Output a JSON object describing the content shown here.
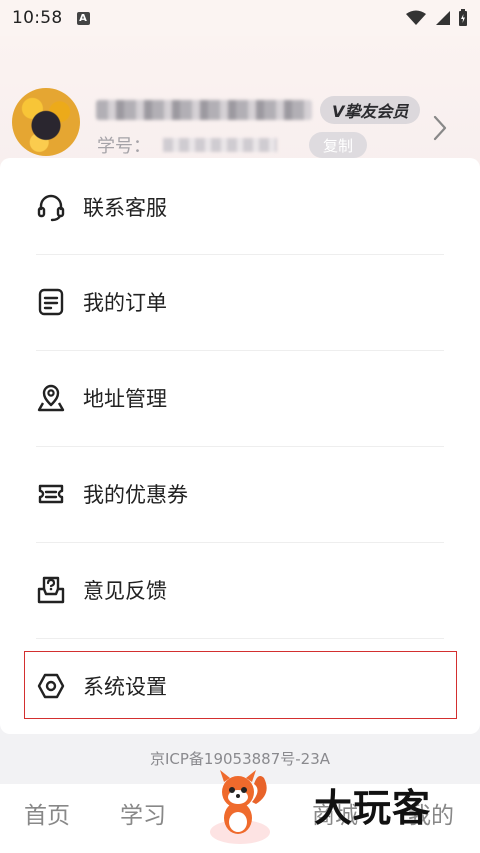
{
  "status_bar": {
    "time": "10:58",
    "indicator": "A"
  },
  "profile": {
    "vip_badge": "V挚友会员",
    "id_label": "学号：",
    "copy_label": "复制"
  },
  "menu": [
    {
      "label": "联系客服",
      "icon": "headset-icon"
    },
    {
      "label": "我的订单",
      "icon": "order-icon"
    },
    {
      "label": "地址管理",
      "icon": "location-icon"
    },
    {
      "label": "我的优惠券",
      "icon": "coupon-icon"
    },
    {
      "label": "意见反馈",
      "icon": "feedback-icon"
    },
    {
      "label": "系统设置",
      "icon": "settings-icon"
    }
  ],
  "footer": {
    "icp": "京ICP备19053887号-23A"
  },
  "nav": {
    "home": "首页",
    "study": "学习",
    "mall": "商城",
    "mine": "我的"
  },
  "watermark": "大玩客",
  "colors": {
    "highlight": "#d32f2f",
    "background": "#f2f2f4"
  }
}
